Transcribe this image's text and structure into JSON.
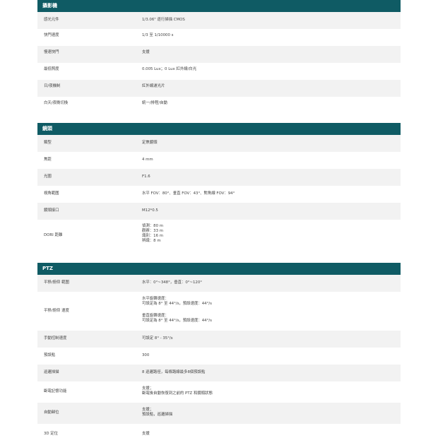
{
  "sections": {
    "camera": {
      "title": "攝影機",
      "rows": [
        {
          "k": "感光元件",
          "v": [
            "1/3.06\" 逐行掃描 CMOS"
          ]
        },
        {
          "k": "快門速度",
          "v": [
            "1/3 至 1/10000 s"
          ]
        },
        {
          "k": "慢速快門",
          "v": [
            "支援"
          ]
        },
        {
          "k": "最低照度",
          "v": [
            "0.005 Lux；0 Lux 紅外線/白光"
          ]
        },
        {
          "k": "日/夜機制",
          "v": [
            "紅外線濾光片"
          ]
        },
        {
          "k": "白天/夜晚切換",
          "v": [
            "統一/排程/自動"
          ]
        }
      ]
    },
    "lens": {
      "title": "鏡頭",
      "rows": [
        {
          "k": "類型",
          "v": [
            "定焦鏡頭"
          ]
        },
        {
          "k": "焦距",
          "v": [
            "4 mm"
          ]
        },
        {
          "k": "光圈",
          "v": [
            "F1.6"
          ]
        },
        {
          "k": "視角範圍",
          "v": [
            "水平 FOV：80°、垂直 FOV：43°、對角線 FOV：94°"
          ]
        },
        {
          "k": "鏡頭接口",
          "v": [
            "M12*0.5"
          ]
        },
        {
          "k": "DORI 距離",
          "v": [
            "偵測：80 m",
            "觀察：33 m",
            "識別：16 m",
            "辨識：8 m"
          ]
        }
      ]
    },
    "ptz": {
      "title": "PTZ",
      "rows": [
        {
          "k": "平移/俯仰 範圍",
          "v": [
            "水平：0°~348°，垂直：0°~120°"
          ]
        },
        {
          "k": "平移/俯仰 速度",
          "v": [
            "水平旋轉速度：",
            "可設定為 8° 至 44°/s，預設速度：44°/s",
            "",
            "垂直旋轉速度：",
            "可設定為 8° 至 44°/s，預設速度：44°/s"
          ]
        },
        {
          "k": "手動控制速度",
          "v": [
            "可設定 8° - 35°/s"
          ]
        },
        {
          "k": "預設點",
          "v": [
            "300"
          ]
        },
        {
          "k": "巡邏掃描",
          "v": [
            "8 巡邏路徑，每條路線最多8個預設點"
          ]
        },
        {
          "k": "斷電記憶功能",
          "v": [
            "支援；",
            "斷電後自動恢復到之前的 PTZ 和鏡頭狀態"
          ]
        },
        {
          "k": "自動歸位",
          "v": [
            "支援；",
            "預設點，巡邏掃描"
          ]
        },
        {
          "k": "3D 定位",
          "v": [
            "支援"
          ]
        }
      ]
    }
  }
}
